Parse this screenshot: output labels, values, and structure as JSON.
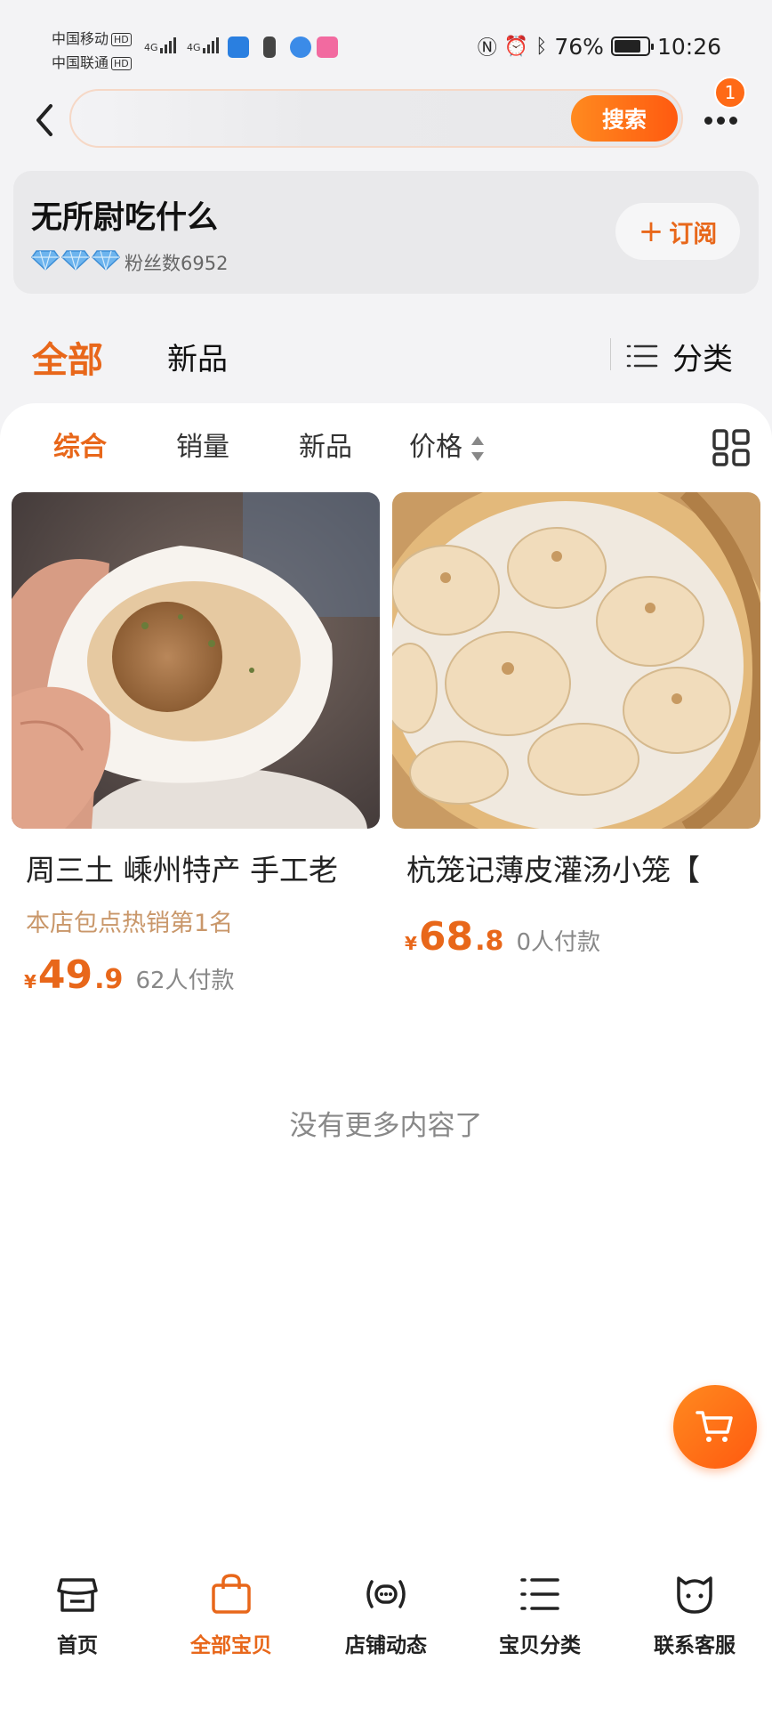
{
  "status_bar": {
    "carrier1": "中国移动",
    "carrier2": "中国联通",
    "hd": "HD",
    "network1": "4G",
    "network2": "4G",
    "battery": "76%",
    "time": "10:26"
  },
  "header": {
    "search_value": "",
    "search_button": "搜索",
    "notification_count": "1"
  },
  "shop": {
    "name": "无所尉吃什么",
    "fans": "粉丝数6952",
    "subscribe": "订阅",
    "subscribe_plus": "+"
  },
  "category_nav": {
    "all": "全部",
    "new": "新品",
    "classify": "分类"
  },
  "sort": {
    "comprehensive": "综合",
    "sales": "销量",
    "new": "新品",
    "price": "价格"
  },
  "products": [
    {
      "title": "周三土  嵊州特产 手工老",
      "tag": "本店包点热销第1名",
      "currency": "¥",
      "price_int": "49",
      "price_dec": ".9",
      "sales": "62人付款"
    },
    {
      "title": "杭笼记薄皮灌汤小笼【",
      "tag": "",
      "currency": "¥",
      "price_int": "68",
      "price_dec": ".8",
      "sales": "0人付款"
    }
  ],
  "no_more": "没有更多内容了",
  "tabs": {
    "home": "首页",
    "all_items": "全部宝贝",
    "shop_news": "店铺动态",
    "categories": "宝贝分类",
    "service": "联系客服"
  },
  "colors": {
    "accent": "#e8671a",
    "tag": "#c9976a"
  }
}
